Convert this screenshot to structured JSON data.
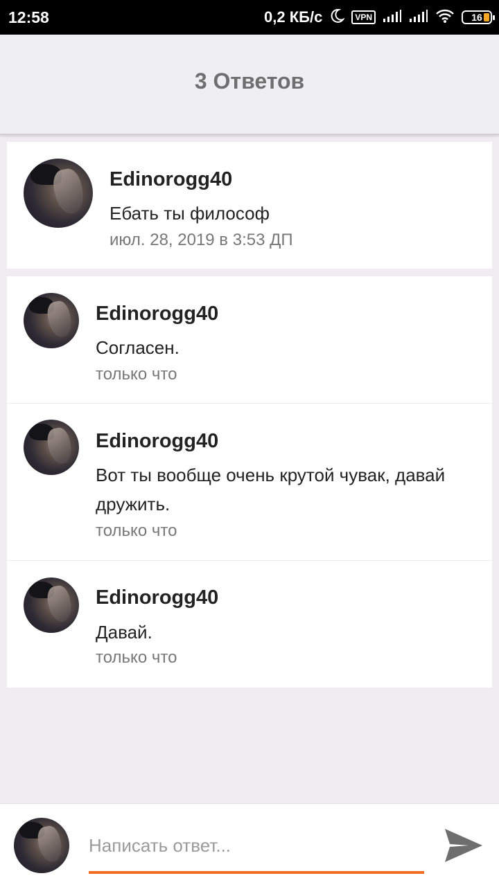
{
  "status_bar": {
    "time": "12:58",
    "net_speed": "0,2 КБ/с",
    "vpn": "VPN",
    "battery": "16"
  },
  "header": {
    "title": "3 Ответов"
  },
  "parent_comment": {
    "author": "Edinorogg40",
    "text": "Ебать ты философ",
    "time": "июл. 28, 2019 в 3:53 ДП"
  },
  "replies": [
    {
      "author": "Edinorogg40",
      "text": "Согласен.",
      "time": "только что"
    },
    {
      "author": "Edinorogg40",
      "text": "Вот ты вообще очень крутой чувак, давай дружить.",
      "time": "только что"
    },
    {
      "author": "Edinorogg40",
      "text": "Давай.",
      "time": "только что"
    }
  ],
  "composer": {
    "placeholder": "Написать ответ...",
    "value": "",
    "send_icon": "send-icon"
  },
  "colors": {
    "accent": "#f36d21",
    "background": "#efedf0",
    "header_text": "#6f6f6f",
    "muted_text": "#777777"
  }
}
